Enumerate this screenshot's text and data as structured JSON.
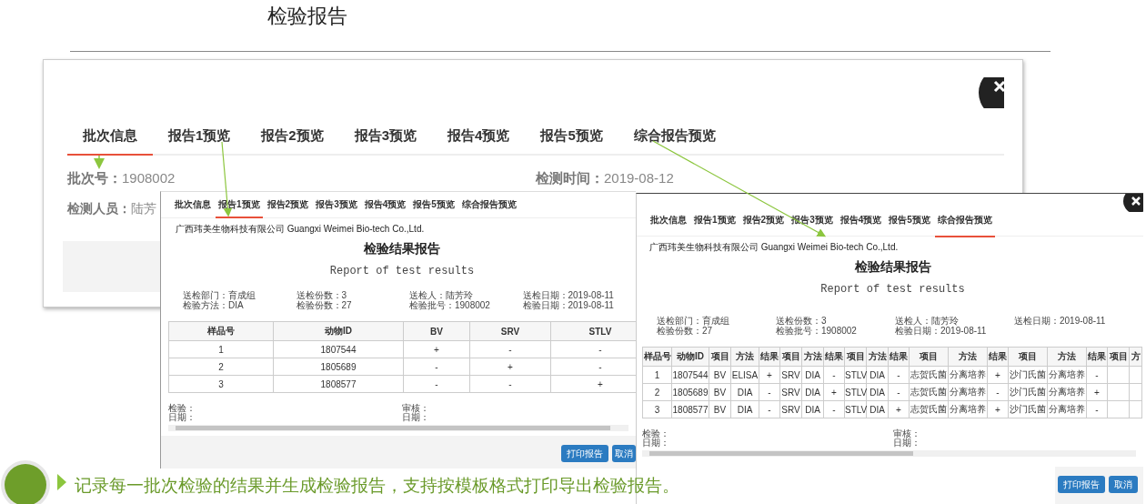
{
  "page_title": "检验报告",
  "main_window": {
    "tabs": [
      {
        "label": "批次信息",
        "selected": true
      },
      {
        "label": "报告1预览",
        "selected": false
      },
      {
        "label": "报告2预览",
        "selected": false
      },
      {
        "label": "报告3预览",
        "selected": false
      },
      {
        "label": "报告4预览",
        "selected": false
      },
      {
        "label": "报告5预览",
        "selected": false
      },
      {
        "label": "综合报告预览",
        "selected": false
      }
    ],
    "fields": [
      [
        "**批次号：**1908002",
        "**检测时间：**2019-08-12"
      ],
      [
        "**检测人员：**陆芳"
      ]
    ]
  },
  "report_windows": [
    {
      "tabs": [
        {
          "label": "批次信息",
          "selected": false
        },
        {
          "label": "报告1预览",
          "selected": true
        },
        {
          "label": "报告2预览",
          "selected": false
        },
        {
          "label": "报告3预览",
          "selected": false
        },
        {
          "label": "报告4预览",
          "selected": false
        },
        {
          "label": "报告5预览",
          "selected": false
        },
        {
          "label": "综合报告预览",
          "selected": false
        }
      ],
      "company": "广西玮美生物科技有限公司 Guangxi Weimei Bio-tech Co.,Ltd.",
      "title": "检验结果报告",
      "subtitle": "Report of test results",
      "info": [
        [
          "送检部门：育成组",
          "送检份数：3",
          "送检人：陆芳玲",
          "送检日期：2019-08-11"
        ],
        [
          "检验方法：DIA",
          "检验份数：27",
          "检验批号：1908002",
          "检验日期：2019-08-11"
        ]
      ],
      "table": {
        "columns": [
          "样品号",
          "动物ID",
          "BV",
          "SRV",
          "STLV"
        ],
        "rows": [
          [
            "1",
            "1807544",
            "+",
            "-",
            "-"
          ],
          [
            "2",
            "1805689",
            "-",
            "+",
            "-"
          ],
          [
            "3",
            "1808577",
            "-",
            "-",
            "+"
          ]
        ]
      },
      "signatures": [
        [
          "检验：",
          "日期："
        ],
        [
          "审核：",
          "日期："
        ]
      ],
      "buttons": [
        "打印报告",
        "取消"
      ]
    },
    {
      "tabs": [
        {
          "label": "批次信息",
          "selected": false
        },
        {
          "label": "报告1预览",
          "selected": false
        },
        {
          "label": "报告2预览",
          "selected": false
        },
        {
          "label": "报告3预览",
          "selected": false
        },
        {
          "label": "报告4预览",
          "selected": false
        },
        {
          "label": "报告5预览",
          "selected": false
        },
        {
          "label": "综合报告预览",
          "selected": true
        }
      ],
      "company": "广西玮美生物科技有限公司 Guangxi Weimei Bio-tech Co.,Ltd.",
      "title": "检验结果报告",
      "subtitle": "Report of test results",
      "info": [
        [
          "送检部门：育成组",
          "送检份数：3",
          "送检人：陆芳玲",
          "送检日期：2019-08-11"
        ],
        [
          "检验份数：27",
          "检验批号：1908002",
          "检验日期：2019-08-11"
        ]
      ],
      "table": {
        "columns": [
          "样品号",
          "动物ID",
          "项目",
          "方法",
          "结果",
          "项目",
          "方法",
          "结果",
          "项目",
          "方法",
          "结果",
          "项目",
          "方法",
          "结果",
          "项目",
          "方法",
          "结果",
          "项目",
          "方"
        ],
        "rows": [
          [
            "1",
            "1807544",
            "BV",
            "ELISA",
            "+",
            "SRV",
            "DIA",
            "-",
            "STLV",
            "DIA",
            "-",
            "志贺氏菌",
            "分离培养",
            "+",
            "沙门氏菌",
            "分离培养",
            "-",
            "",
            ""
          ],
          [
            "2",
            "1805689",
            "BV",
            "DIA",
            "-",
            "SRV",
            "DIA",
            "+",
            "STLV",
            "DIA",
            "-",
            "志贺氏菌",
            "分离培养",
            "-",
            "沙门氏菌",
            "分离培养",
            "+",
            "",
            ""
          ],
          [
            "3",
            "1808577",
            "BV",
            "DIA",
            "-",
            "SRV",
            "DIA",
            "-",
            "STLV",
            "DIA",
            "+",
            "志贺氏菌",
            "分离培养",
            "+",
            "沙门氏菌",
            "分离培养",
            "-",
            "",
            ""
          ]
        ]
      },
      "signatures": [
        [
          "检验：",
          "日期："
        ],
        [
          "审核：",
          "日期："
        ]
      ],
      "buttons": [
        "打印报告",
        "取消"
      ]
    }
  ],
  "caption": "记录每一批次检验的结果并生成检验报告，支持按模板格式打印导出检验报告。"
}
